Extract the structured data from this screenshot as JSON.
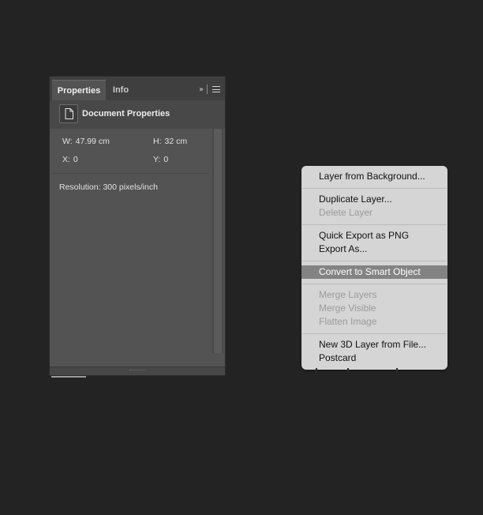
{
  "panel": {
    "tabs": [
      {
        "label": "Properties",
        "active": true
      },
      {
        "label": "Info",
        "active": false
      }
    ],
    "expand_icon": "double-chevron-right-icon",
    "menu_icon": "hamburger-menu-icon",
    "header": {
      "icon": "document-icon",
      "title": "Document Properties"
    },
    "fields": {
      "width": {
        "label": "W:",
        "value": "47.99 cm"
      },
      "height": {
        "label": "H:",
        "value": "32 cm"
      },
      "x": {
        "label": "X:",
        "value": "0"
      },
      "y": {
        "label": "Y:",
        "value": "0"
      }
    },
    "resolution": "Resolution: 300 pixels/inch"
  },
  "context_menu": {
    "groups": [
      [
        {
          "label": "Layer from Background...",
          "enabled": true
        }
      ],
      [
        {
          "label": "Duplicate Layer...",
          "enabled": true
        },
        {
          "label": "Delete Layer",
          "enabled": false
        }
      ],
      [
        {
          "label": "Quick Export as PNG",
          "enabled": true
        },
        {
          "label": "Export As...",
          "enabled": true
        }
      ],
      [
        {
          "label": "Convert to Smart Object",
          "enabled": true,
          "highlighted": true
        }
      ],
      [
        {
          "label": "Merge Layers",
          "enabled": false
        },
        {
          "label": "Merge Visible",
          "enabled": false
        },
        {
          "label": "Flatten Image",
          "enabled": false
        }
      ],
      [
        {
          "label": "New 3D Layer from File...",
          "enabled": true
        },
        {
          "label": "Postcard",
          "enabled": true
        }
      ]
    ]
  },
  "colors": {
    "background": "#232323",
    "panel": "#535353",
    "menu": "#d5d5d5",
    "menu_highlight": "#838383"
  }
}
